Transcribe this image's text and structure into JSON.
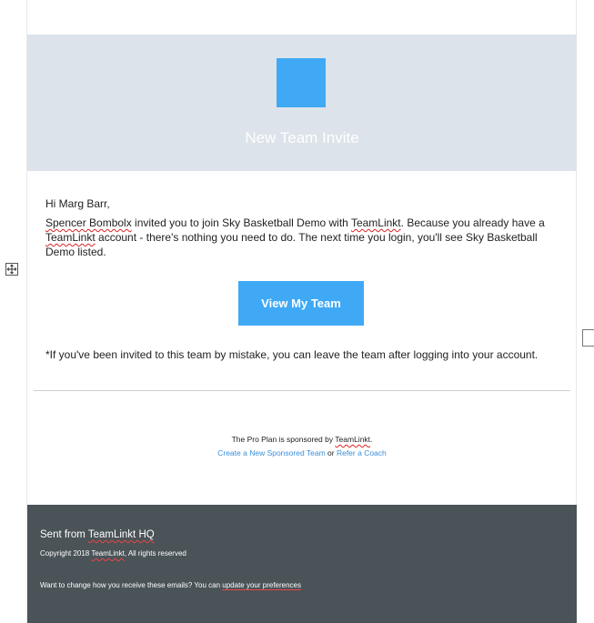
{
  "hero": {
    "title": "New Team Invite",
    "accent_color": "#3fa9f5",
    "background": "#dce3ea"
  },
  "greeting": "Hi Marg Barr,",
  "invite": {
    "inviter": "Spencer Bombolx",
    "text_1": " invited you to join Sky Basketball Demo with ",
    "brand": "TeamLinkt",
    "text_2": ". Because you already have a ",
    "text_3": " account - there's nothing you need to do. The next time you login, you'll see Sky Basketball Demo listed."
  },
  "cta": {
    "label": "View My Team"
  },
  "mistake_note": "*If you've been invited to this team by mistake, you can leave the team after logging into your account.",
  "sponsor": {
    "prefix": "The Pro Plan is sponsored by ",
    "brand": "TeamLinkt",
    "suffix": ".",
    "create_link": "Create a New Sponsored Team",
    "or": " or ",
    "refer_link": "Refer a Coach"
  },
  "footer": {
    "sent_prefix": "Sent from ",
    "sent_brand": "TeamLinkt HQ",
    "copyright_prefix": "Copyright 2018 ",
    "copyright_brand": "TeamLinkt",
    "copyright_suffix": ", All rights reserved",
    "prefs_text": "Want to change how you receive these emails? You can ",
    "prefs_link": "update your preferences",
    "background": "#4a5358"
  },
  "icons": {
    "move_handle": "move-handle-icon",
    "resize_handle": "resize-handle-icon"
  }
}
